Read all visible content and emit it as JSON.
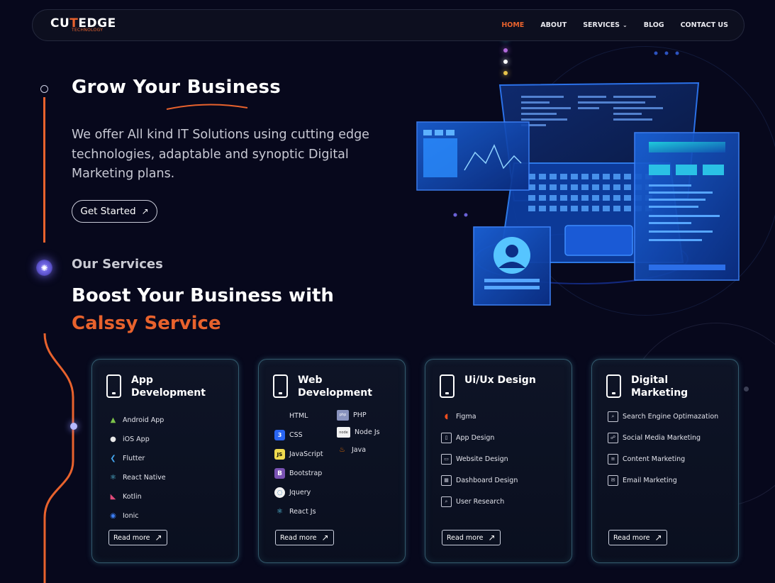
{
  "brand": {
    "logo_main_a": "CU",
    "logo_main_b": "T",
    "logo_main_c": "EDGE",
    "logo_sub": "TECHNOLOGY"
  },
  "nav": {
    "items": [
      {
        "label": "HOME",
        "active": true
      },
      {
        "label": "ABOUT"
      },
      {
        "label": "SERVICES",
        "dropdown": true
      },
      {
        "label": "BLOG"
      },
      {
        "label": "CONTACT US"
      }
    ]
  },
  "hero": {
    "title": "Grow Your Business",
    "text": "We offer All kind IT Solutions using cutting edge technologies, adaptable and synoptic Digital Marketing plans.",
    "cta": "Get Started"
  },
  "services": {
    "label": "Our Services",
    "title_line1": "Boost Your Business with",
    "title_line2": "Calssy Service",
    "read_more": "Read more",
    "cards": [
      {
        "title": "App Development",
        "items": [
          {
            "label": "Android App",
            "icon": "android-icon"
          },
          {
            "label": "iOS App",
            "icon": "apple-icon"
          },
          {
            "label": "Flutter",
            "icon": "flutter-icon"
          },
          {
            "label": "React Native",
            "icon": "react-icon"
          },
          {
            "label": "Kotlin",
            "icon": "kotlin-icon"
          },
          {
            "label": "Ionic",
            "icon": "ionic-icon"
          }
        ]
      },
      {
        "title": "Web Development",
        "items": [
          {
            "label": "HTML",
            "icon": "html-icon"
          },
          {
            "label": "CSS",
            "icon": "css-icon"
          },
          {
            "label": "JavaScript",
            "icon": "javascript-icon"
          },
          {
            "label": "Bootstrap",
            "icon": "bootstrap-icon"
          },
          {
            "label": "Jquery",
            "icon": "jquery-icon"
          },
          {
            "label": "React Js",
            "icon": "react-icon"
          }
        ],
        "items2": [
          {
            "label": "PHP",
            "icon": "php-icon"
          },
          {
            "label": "Node Js",
            "icon": "nodejs-icon"
          },
          {
            "label": "Java",
            "icon": "java-icon"
          }
        ]
      },
      {
        "title": "Ui/Ux Design",
        "items": [
          {
            "label": "Figma",
            "icon": "figma-icon"
          },
          {
            "label": "App Design",
            "icon": "mobile-design-icon"
          },
          {
            "label": "Website Design",
            "icon": "website-design-icon"
          },
          {
            "label": "Dashboard Design",
            "icon": "dashboard-icon"
          },
          {
            "label": "User Research",
            "icon": "user-research-icon"
          }
        ]
      },
      {
        "title": "Digital Marketing",
        "items": [
          {
            "label": "Search Engine Optimazation",
            "icon": "seo-icon"
          },
          {
            "label": "Social Media Marketing",
            "icon": "social-media-icon"
          },
          {
            "label": "Content Marketing",
            "icon": "content-icon"
          },
          {
            "label": "Email Marketing",
            "icon": "email-icon"
          }
        ]
      }
    ]
  },
  "colors": {
    "accent": "#e8622d",
    "background": "#07081c",
    "card_border": "#5496aa"
  }
}
